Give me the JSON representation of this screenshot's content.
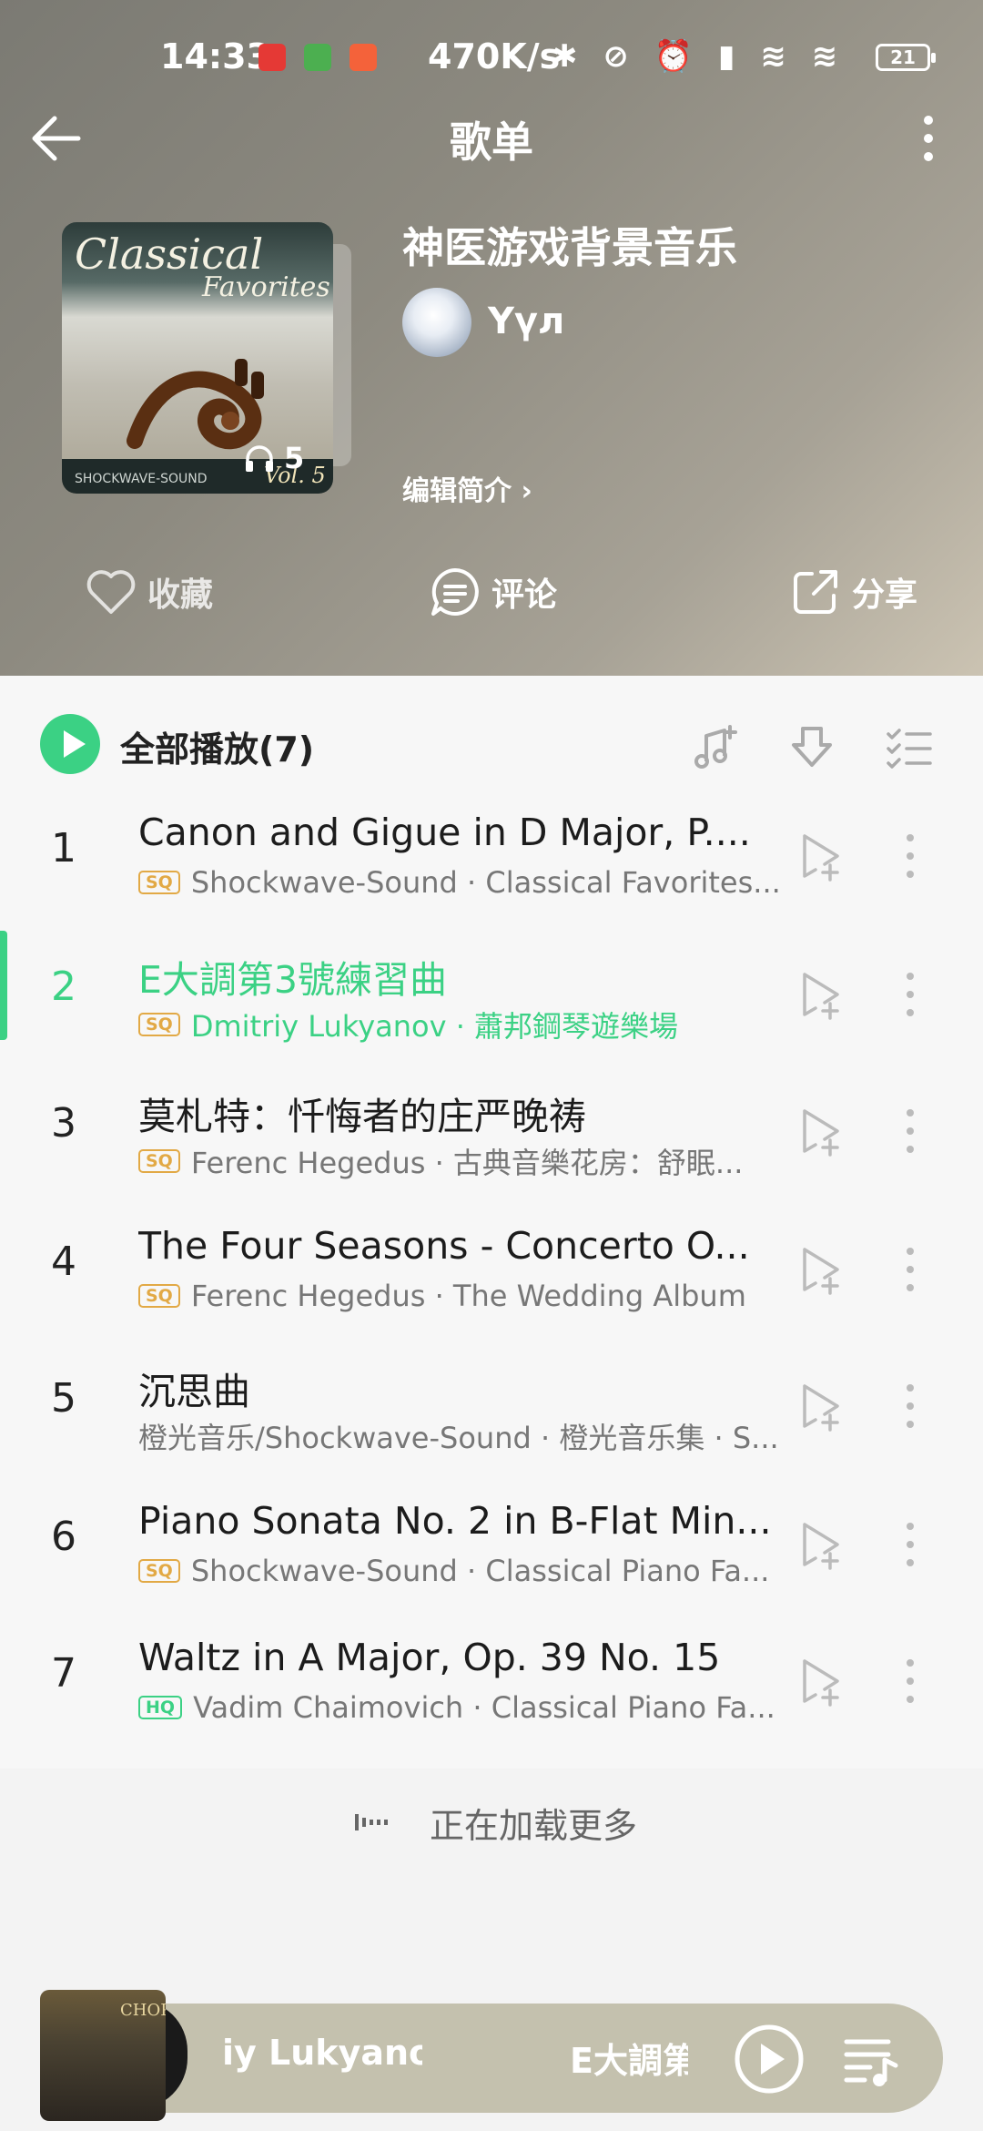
{
  "status_bar": {
    "time": "14:33",
    "speed": "470K/s",
    "icons": "✱ ⊘ ⏰ ▮ ≋ ≋",
    "battery": "21"
  },
  "header": {
    "title": "歌单",
    "playlist_name": "神医游戏背景音乐",
    "username": "Yүл",
    "edit_intro": "编辑简介 ›",
    "cover": {
      "line1": "Classical",
      "line2": "Favorites",
      "brand": "SHOCKWAVE-SOUND",
      "vol": "Vol. 5"
    },
    "play_count": "5"
  },
  "actions": {
    "collect": "收藏",
    "comment": "评论",
    "share": "分享"
  },
  "list": {
    "play_all": "全部播放(7)",
    "songs": [
      {
        "idx": "1",
        "name": "Canon and Gigue in D Major, P....",
        "badge": "SQ",
        "meta": "Shockwave-Sound · Classical Favorites..."
      },
      {
        "idx": "2",
        "name": "E大調第3號練習曲",
        "badge": "SQ",
        "meta": "Dmitriy Lukyanov · 蕭邦鋼琴遊樂場"
      },
      {
        "idx": "3",
        "name": "莫札特：忏悔者的庄严晚祷",
        "badge": "SQ",
        "meta": "Ferenc Hegedus · 古典音樂花房：舒眠..."
      },
      {
        "idx": "4",
        "name": "The Four Seasons - Concerto O...",
        "badge": "SQ",
        "meta": "Ferenc Hegedus · The Wedding Album"
      },
      {
        "idx": "5",
        "name": "沉思曲",
        "badge": "",
        "meta": "橙光音乐/Shockwave-Sound · 橙光音乐集 · S..."
      },
      {
        "idx": "6",
        "name": "Piano Sonata No. 2 in B-Flat Min...",
        "badge": "SQ",
        "meta": "Shockwave-Sound · Classical Piano Fa..."
      },
      {
        "idx": "7",
        "name": "Waltz in A Major, Op. 39 No. 15",
        "badge": "HQ",
        "meta": "Vadim Chaimovich · Classical Piano Fa..."
      }
    ],
    "active_index": 2,
    "loading_text": "正在加载更多"
  },
  "mini_player": {
    "artist": "iy Lukyanov",
    "title": "E大調第",
    "cover_label": "CHOPIN"
  },
  "colors": {
    "accent": "#3bd184",
    "sq_badge": "#e2a945"
  }
}
